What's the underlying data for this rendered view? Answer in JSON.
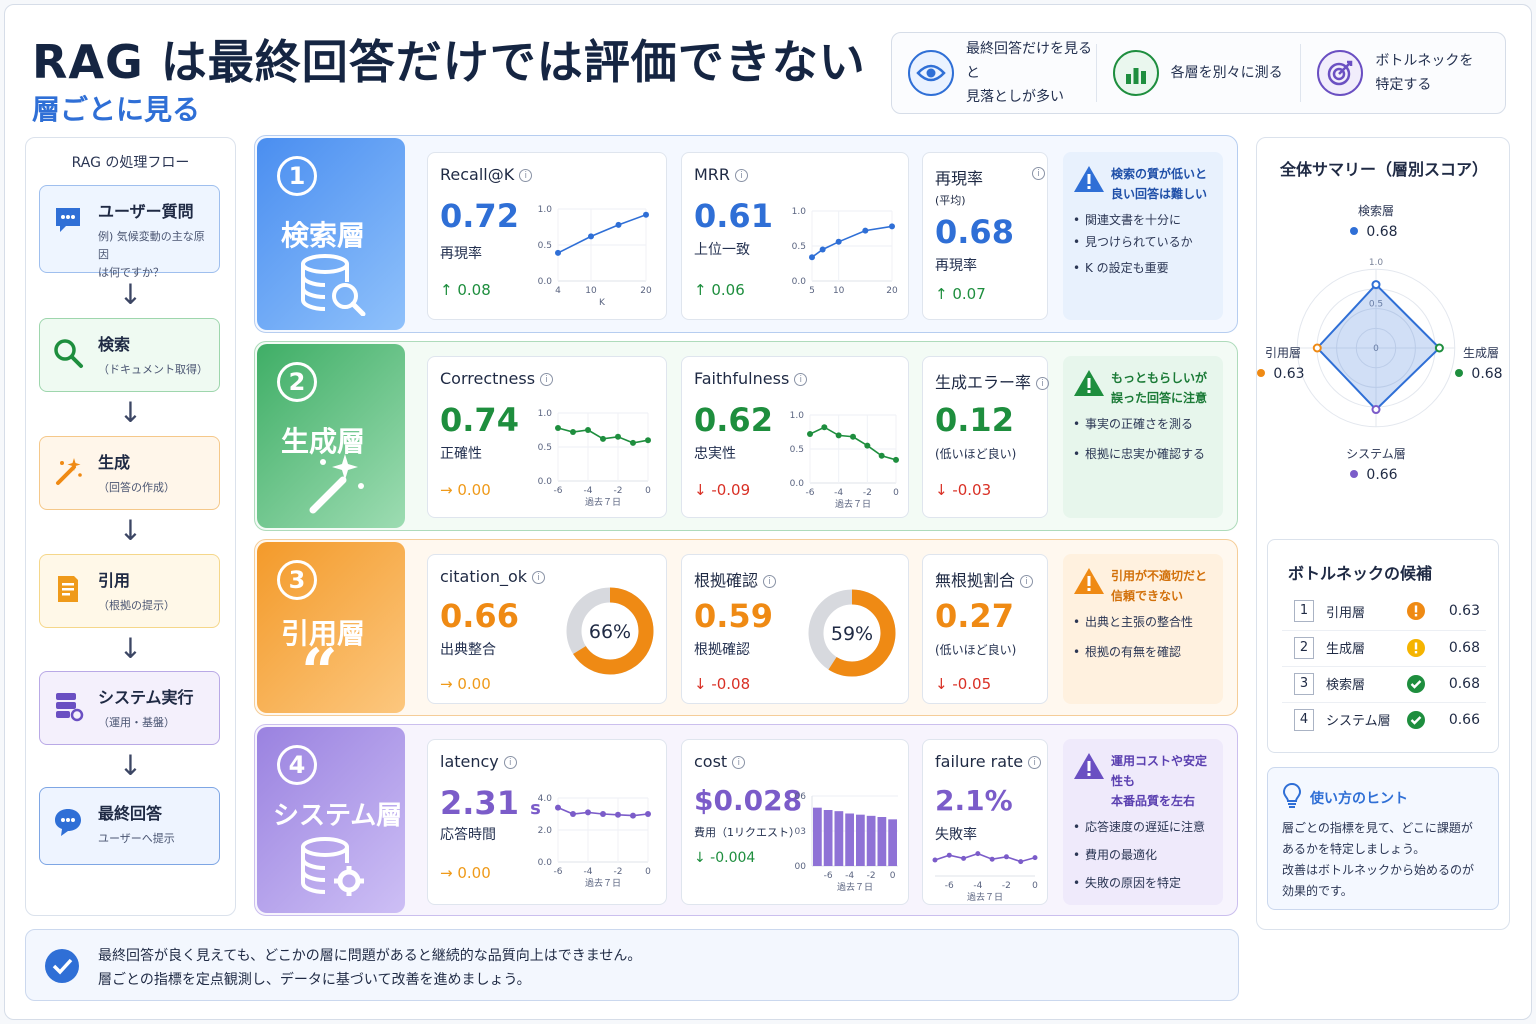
{
  "header": {
    "title": "RAG は最終回答だけでは評価できない",
    "subtitle": "層ごとに見る",
    "pills": [
      {
        "icon": "eye-icon",
        "line1": "最終回答だけを見ると",
        "line2": "見落としが多い"
      },
      {
        "icon": "bar-chart-icon",
        "line1": "各層を別々に測る",
        "line2": ""
      },
      {
        "icon": "target-icon",
        "line1": "ボトルネックを",
        "line2": "特定する"
      }
    ]
  },
  "flow": {
    "heading": "RAG の処理フロー",
    "steps": [
      {
        "title": "ユーザー質問",
        "sub1": "例) 気候変動の主な原因",
        "sub2": "は何ですか？",
        "icon": "chat-icon"
      },
      {
        "title": "検索",
        "sub1": "（ドキュメント取得）",
        "sub2": "",
        "icon": "search-icon"
      },
      {
        "title": "生成",
        "sub1": "（回答の作成）",
        "sub2": "",
        "icon": "magic-wand-icon"
      },
      {
        "title": "引用",
        "sub1": "（根拠の提示）",
        "sub2": "",
        "icon": "document-icon"
      },
      {
        "title": "システム実行",
        "sub1": "（運用・基盤）",
        "sub2": "",
        "icon": "server-icon"
      },
      {
        "title": "最終回答",
        "sub1": "ユーザーへ提示",
        "sub2": "",
        "icon": "chat-icon"
      }
    ]
  },
  "layers": [
    {
      "num": "1",
      "name": "検索層",
      "cards": [
        {
          "title": "Recall@K",
          "value": "0.72",
          "sub": "再現率",
          "delta": "↑ 0.08",
          "dir": "up"
        },
        {
          "title": "MRR",
          "value": "0.61",
          "sub": "上位一致",
          "delta": "↑ 0.06",
          "dir": "up"
        },
        {
          "title": "再現率",
          "title_sub": "(平均)",
          "value": "0.68",
          "sub": "再現率",
          "delta": "↑ 0.07",
          "dir": "up"
        }
      ],
      "tip": {
        "title1": "検索の質が低いと",
        "title2": "良い回答は難しい",
        "bullets": [
          "関連文書を十分に",
          "見つけられているか",
          "K の設定も重要"
        ]
      }
    },
    {
      "num": "2",
      "name": "生成層",
      "cards": [
        {
          "title": "Correctness",
          "value": "0.74",
          "sub": "正確性",
          "delta": "→ 0.00",
          "dir": "flat"
        },
        {
          "title": "Faithfulness",
          "value": "0.62",
          "sub": "忠実性",
          "delta": "↓ -0.09",
          "dir": "down"
        },
        {
          "title": "生成エラー率",
          "value": "0.12",
          "sub": "(低いほど良い)",
          "delta": "↓ -0.03",
          "dir": "down"
        }
      ],
      "tip": {
        "title1": "もっともらしいが",
        "title2": "誤った回答に注意",
        "bullets": [
          "事実の正確さを測る",
          "根拠に忠実か確認する"
        ]
      }
    },
    {
      "num": "3",
      "name": "引用層",
      "cards": [
        {
          "title": "citation_ok",
          "value": "0.66",
          "sub": "出典整合",
          "delta": "→ 0.00",
          "dir": "flat",
          "donut": "66%"
        },
        {
          "title": "根拠確認",
          "value": "0.59",
          "sub": "根拠確認",
          "delta": "↓ -0.08",
          "dir": "down",
          "donut": "59%"
        },
        {
          "title": "無根拠割合",
          "value": "0.27",
          "sub": "(低いほど良い)",
          "delta": "↓ -0.05",
          "dir": "down"
        }
      ],
      "tip": {
        "title1": "引用が不適切だと",
        "title2": "信頼できない",
        "bullets": [
          "出典と主張の整合性",
          "根拠の有無を確認"
        ]
      }
    },
    {
      "num": "4",
      "name": "システム層",
      "cards": [
        {
          "title": "latency",
          "value": "2.31",
          "unit": "s",
          "sub": "応答時間",
          "delta": "→ 0.00",
          "dir": "flat"
        },
        {
          "title": "cost",
          "value": "$0.028",
          "sub": "費用（1リクエスト）",
          "delta": "↓ -0.004",
          "dir": "up"
        },
        {
          "title": "failure rate",
          "value": "2.1%",
          "sub": "失敗率",
          "delta": "",
          "dir": "up"
        }
      ],
      "tip": {
        "title1": "運用コストや安定性も",
        "title2": "本番品質を左右",
        "bullets": [
          "応答速度の遅延に注意",
          "費用の最適化",
          "失敗の原因を特定"
        ]
      }
    }
  ],
  "chart_data": [
    {
      "type": "line",
      "id": "recall",
      "x": [
        4,
        10,
        15,
        20
      ],
      "y": [
        0.39,
        0.62,
        0.78,
        0.92
      ],
      "xticks": [
        "4",
        "10",
        "20"
      ],
      "yticks": [
        "1.0",
        "0.5",
        "0.0"
      ],
      "xlabel": "K",
      "ylim": [
        0,
        1.0
      ],
      "color": "#2f6fd6"
    },
    {
      "type": "line",
      "id": "mrr",
      "x": [
        5,
        7,
        10,
        15,
        20
      ],
      "y": [
        0.34,
        0.45,
        0.56,
        0.72,
        0.78
      ],
      "xticks": [
        "5",
        "10",
        "20"
      ],
      "yticks": [
        "1.0",
        "0.5",
        "0.0"
      ],
      "xlabel": "",
      "ylim": [
        0,
        1.0
      ],
      "color": "#2f6fd6"
    },
    {
      "type": "line",
      "id": "correctness",
      "x": [
        -6,
        -5,
        -4,
        -3,
        -2,
        -1,
        0
      ],
      "y": [
        0.78,
        0.72,
        0.75,
        0.62,
        0.65,
        0.56,
        0.6
      ],
      "xticks": [
        "-6",
        "-4",
        "-2",
        "0"
      ],
      "yticks": [
        "1.0",
        "0.5",
        "0.0"
      ],
      "xlabel": "過去７日",
      "ylim": [
        0,
        1.0
      ],
      "color": "#1e8e3e"
    },
    {
      "type": "line",
      "id": "faithfulness",
      "x": [
        -6,
        -5,
        -4,
        -3,
        -2,
        -1,
        0
      ],
      "y": [
        0.72,
        0.82,
        0.7,
        0.68,
        0.55,
        0.4,
        0.34
      ],
      "xticks": [
        "-6",
        "-4",
        "-2",
        "0"
      ],
      "yticks": [
        "1.0",
        "0.5",
        "0.0"
      ],
      "xlabel": "過去７日",
      "ylim": [
        0,
        1.0
      ],
      "color": "#1e8e3e"
    },
    {
      "type": "pie",
      "id": "citation",
      "values": [
        0.66,
        0.34
      ],
      "label": "66%",
      "color": "#ef8a14"
    },
    {
      "type": "pie",
      "id": "grounding",
      "values": [
        0.59,
        0.41
      ],
      "label": "59%",
      "color": "#ef8a14"
    },
    {
      "type": "line",
      "id": "latency",
      "x": [
        -6,
        -5,
        -4,
        -3,
        -2,
        -1,
        0
      ],
      "y": [
        3.4,
        3.0,
        3.1,
        3.0,
        2.95,
        2.9,
        3.0
      ],
      "xticks": [
        "-6",
        "-4",
        "-2",
        "0"
      ],
      "yticks": [
        "4.0",
        "2.0",
        "0.0"
      ],
      "xlabel": "過去７日",
      "ylim": [
        0,
        4.0
      ],
      "color": "#7b5cc9"
    },
    {
      "type": "bar",
      "id": "cost",
      "x": [
        -7,
        -6,
        -5,
        -4,
        -3,
        -2,
        -1,
        0
      ],
      "values": [
        0.05,
        0.048,
        0.047,
        0.045,
        0.044,
        0.043,
        0.042,
        0.04
      ],
      "xticks": [
        "-6",
        "-4",
        "-2",
        "0"
      ],
      "yticks": [
        "0.06",
        "0.03",
        "0.00"
      ],
      "xlabel": "過去７日",
      "ylim": [
        0,
        0.06
      ],
      "color": "#8f72d6"
    },
    {
      "type": "line",
      "id": "failure",
      "x": [
        -7,
        -6,
        -5,
        -4,
        -3,
        -2,
        -1,
        0
      ],
      "y": [
        2.0,
        2.6,
        2.2,
        2.8,
        2.1,
        2.4,
        1.8,
        2.3
      ],
      "xticks": [
        "-6",
        "-4",
        "-2",
        "0"
      ],
      "yticks": [],
      "xlabel": "過去７日",
      "ylim": [
        0,
        4
      ],
      "color": "#7b5cc9"
    },
    {
      "type": "radar",
      "id": "radar",
      "title": "全体サマリー（層別スコア）",
      "axes": [
        "検索層",
        "生成層",
        "システム層",
        "引用層"
      ],
      "values": [
        0.68,
        0.68,
        0.66,
        0.63
      ],
      "labels": [
        "0.68",
        "0.68",
        "0.66",
        "0.63"
      ],
      "ticks": [
        "1.0",
        "0.5",
        "0"
      ],
      "color": "#2f6fd6"
    }
  ],
  "bottleneck": {
    "title": "ボトルネックの候補",
    "rows": [
      {
        "rank": "1",
        "name": "引用層",
        "score": "0.63",
        "status": "warning"
      },
      {
        "rank": "2",
        "name": "生成層",
        "score": "0.68",
        "status": "caution"
      },
      {
        "rank": "3",
        "name": "検索層",
        "score": "0.68",
        "status": "ok"
      },
      {
        "rank": "4",
        "name": "システム層",
        "score": "0.66",
        "status": "ok"
      }
    ]
  },
  "hint": {
    "title": "使い方のヒント",
    "lines": [
      "層ごとの指標を見て、どこに課題が",
      "あるかを特定しましょう。",
      "改善はボトルネックから始めるのが",
      "効果的です。"
    ]
  },
  "footer": {
    "line1": "最終回答が良く見えても、どこかの層に問題があると継続的な品質向上はできません。",
    "line2": "層ごとの指標を定点観測し、データに基づいて改善を進めましょう。"
  }
}
